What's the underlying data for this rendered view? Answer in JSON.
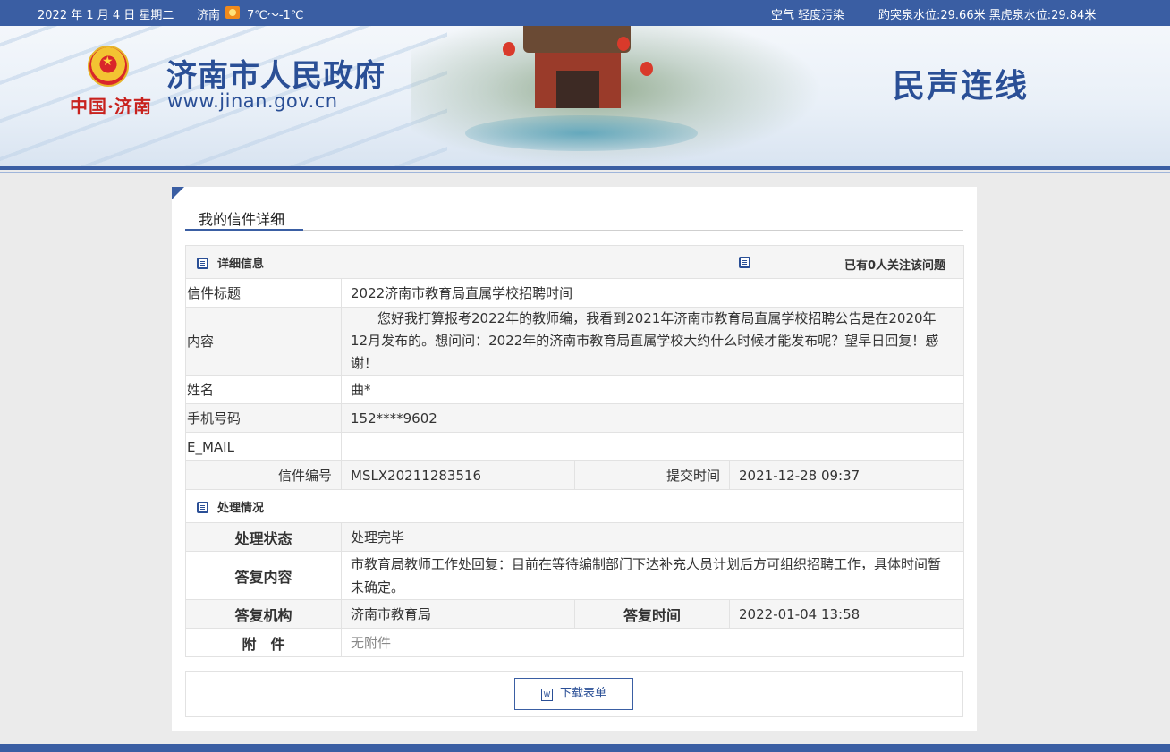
{
  "topbar": {
    "date": "2022 年 1 月 4 日 星期二",
    "city": "济南",
    "weather_icon": "sun-icon",
    "temperature": "7℃～-1℃",
    "air_quality": "空气 轻度污染",
    "spring_levels": "趵突泉水位:29.66米 黑虎泉水位:29.84米"
  },
  "header": {
    "brand_seal": "中国·济南",
    "site_title": "济南市人民政府",
    "site_url": "www.jinan.gov.cn",
    "section_title": "民声连线"
  },
  "panel": {
    "tab_title": "我的信件详细"
  },
  "details": {
    "section_label": "详细信息",
    "followers_text": "已有0人关注该问题",
    "title_label": "信件标题",
    "title_value": "2022济南市教育局直属学校招聘时间",
    "content_label": "内容",
    "content_value": "您好我打算报考2022年的教师编，我看到2021年济南市教育局直属学校招聘公告是在2020年12月发布的。想问问：2022年的济南市教育局直属学校大约什么时候才能发布呢？望早日回复！感谢！",
    "name_label": "姓名",
    "name_value": "曲*",
    "phone_label": "手机号码",
    "phone_value": "152****9602",
    "email_label": "E_MAIL",
    "email_value": "",
    "letter_no_label": "信件编号",
    "letter_no_value": "MSLX20211283516",
    "submit_time_label": "提交时间",
    "submit_time_value": "2021-12-28 09:37"
  },
  "processing": {
    "section_label": "处理情况",
    "status_label": "处理状态",
    "status_value": "处理完毕",
    "reply_label": "答复内容",
    "reply_value": "市教育局教师工作处回复：目前在等待编制部门下达补充人员计划后方可组织招聘工作，具体时间暂未确定。",
    "org_label": "答复机构",
    "org_value": "济南市教育局",
    "reply_time_label": "答复时间",
    "reply_time_value": "2022-01-04 13:58",
    "attachment_label": "附　件",
    "attachment_value": "无附件"
  },
  "download": {
    "icon_letter": "W",
    "label": "下载表单"
  },
  "colors": {
    "primary": "#3a5ea3",
    "title_blue": "#2a4f96",
    "row_gray": "#f5f5f5"
  }
}
